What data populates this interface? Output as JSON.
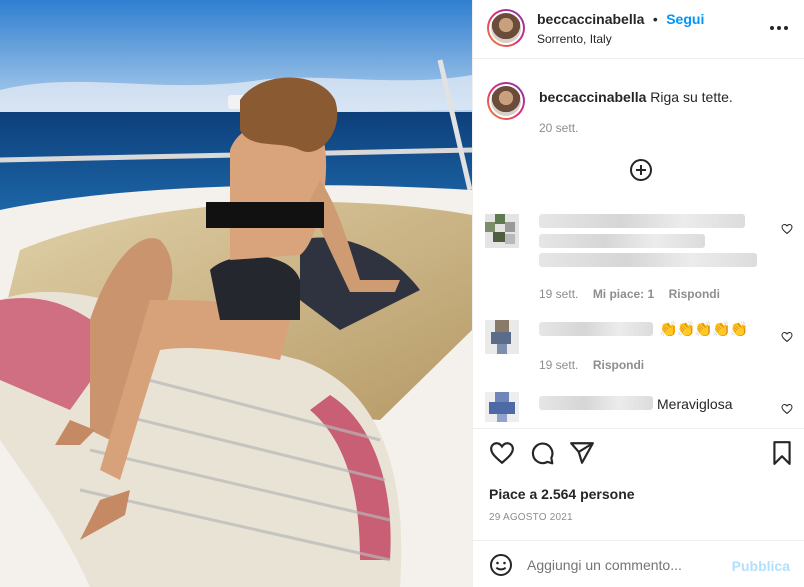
{
  "post": {
    "username": "beccaccinabella",
    "follow_label": "Segui",
    "location": "Sorrento, Italy",
    "more_icon": "more-horizontal-icon"
  },
  "caption": {
    "username": "beccaccinabella",
    "text": "Riga su tette.",
    "time": "20 sett."
  },
  "comments": [
    {
      "time": "19 sett.",
      "likes": "Mi piace: 1",
      "reply": "Rispondi"
    },
    {
      "emojis": "👏👏👏👏👏",
      "time": "19 sett.",
      "reply": "Rispondi"
    },
    {
      "text": "Meraviglosa"
    }
  ],
  "actions": {
    "likes": "Piace a 2.564 persone",
    "date": "29 AGOSTO 2021"
  },
  "composer": {
    "placeholder": "Aggiungi un commento...",
    "publish": "Pubblica"
  },
  "colors": {
    "accent": "#0095f6",
    "text": "#262626",
    "muted": "#8e8e8e"
  }
}
